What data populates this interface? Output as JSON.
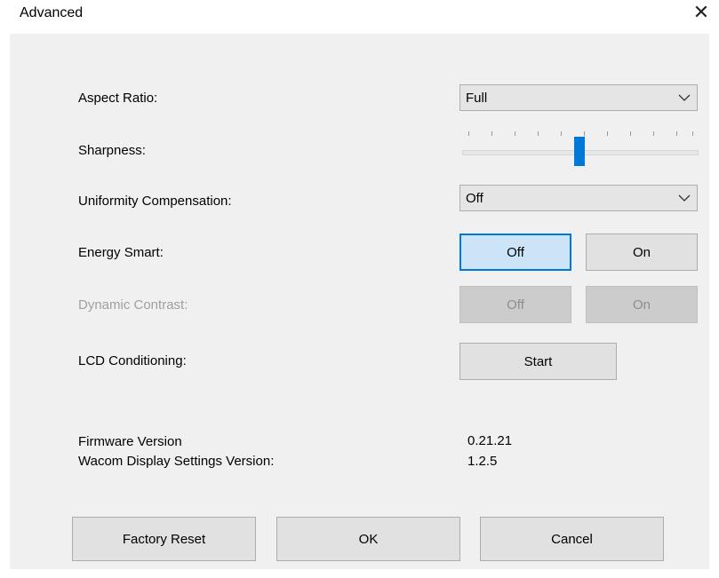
{
  "window": {
    "title": "Advanced",
    "close_icon": "close-icon"
  },
  "aspect_ratio": {
    "label": "Aspect Ratio:",
    "value": "Full"
  },
  "sharpness": {
    "label": "Sharpness:",
    "level": 0.5
  },
  "uniformity": {
    "label": "Uniformity Compensation:",
    "value": "Off"
  },
  "energy_smart": {
    "label": "Energy Smart:",
    "off_label": "Off",
    "on_label": "On",
    "selected": "Off"
  },
  "dynamic_contrast": {
    "label": "Dynamic Contrast:",
    "off_label": "Off",
    "on_label": "On",
    "enabled": false
  },
  "lcd_conditioning": {
    "label": "LCD Conditioning:",
    "start_label": "Start"
  },
  "info": {
    "firmware_label": "Firmware Version",
    "firmware_value": "0.21.21",
    "settings_label": "Wacom Display Settings Version:",
    "settings_value": "1.2.5"
  },
  "footer": {
    "factory_reset": "Factory Reset",
    "ok": "OK",
    "cancel": "Cancel"
  },
  "colors": {
    "accent": "#0078d7",
    "selected_bg": "#cce4f7",
    "panel_bg": "#f0f0f0"
  }
}
